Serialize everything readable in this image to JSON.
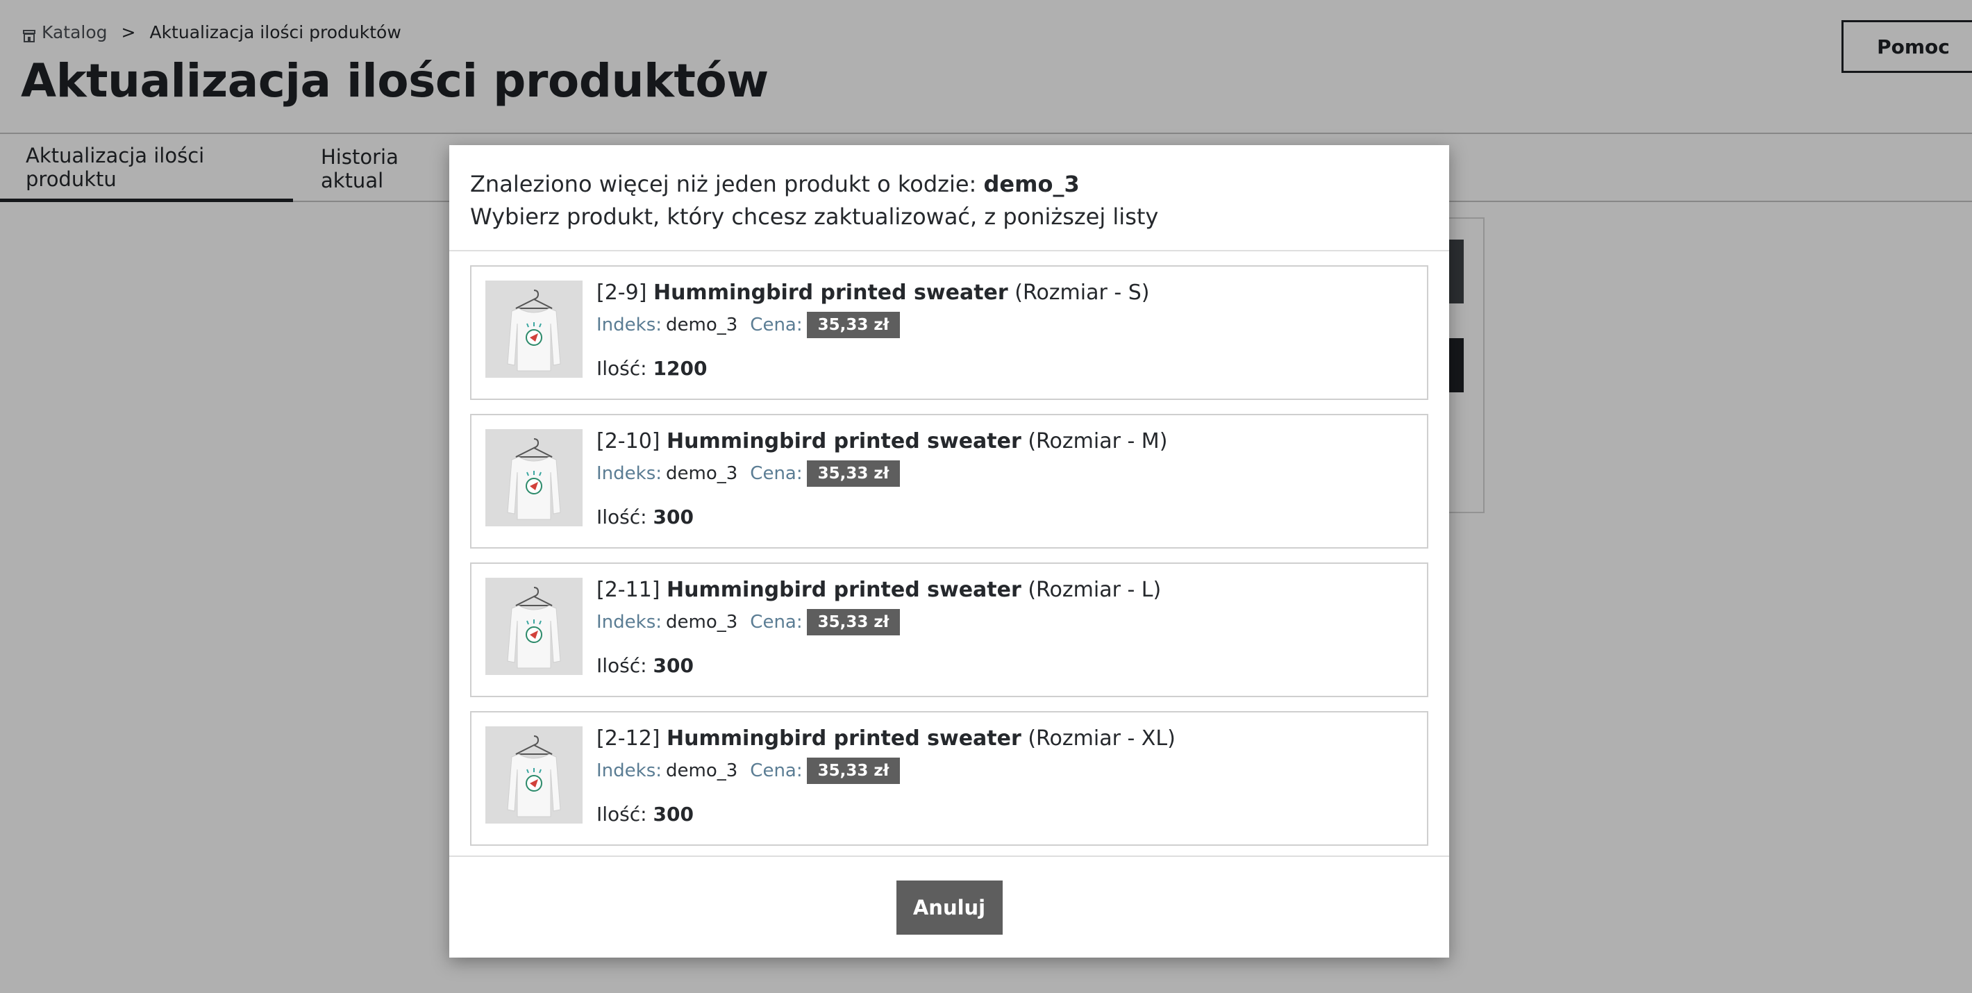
{
  "breadcrumb": {
    "root": "Katalog",
    "separator": ">",
    "current": "Aktualizacja ilości produktów"
  },
  "page": {
    "title": "Aktualizacja ilości produktów",
    "help_label": "Pomoc"
  },
  "tabs": [
    {
      "label": "Aktualizacja ilości produktu",
      "active": true
    },
    {
      "label": "Historia aktual",
      "active": false
    }
  ],
  "modal": {
    "line1_prefix": "Znaleziono więcej niż jeden produkt o kodzie: ",
    "code": "demo_3",
    "line2": "Wybierz produkt, który chcesz zaktualizować, z poniższej listy",
    "cancel_label": "Anuluj",
    "labels": {
      "index": "Indeks:",
      "price": "Cena:",
      "qty": "Ilość:"
    },
    "products": [
      {
        "id": "[2-9]",
        "name": "Hummingbird printed sweater",
        "variant": "(Rozmiar - S)",
        "index": "demo_3",
        "price": "35,33 zł",
        "qty": "1200"
      },
      {
        "id": "[2-10]",
        "name": "Hummingbird printed sweater",
        "variant": "(Rozmiar - M)",
        "index": "demo_3",
        "price": "35,33 zł",
        "qty": "300"
      },
      {
        "id": "[2-11]",
        "name": "Hummingbird printed sweater",
        "variant": "(Rozmiar - L)",
        "index": "demo_3",
        "price": "35,33 zł",
        "qty": "300"
      },
      {
        "id": "[2-12]",
        "name": "Hummingbird printed sweater",
        "variant": "(Rozmiar - XL)",
        "index": "demo_3",
        "price": "35,33 zł",
        "qty": "300"
      }
    ]
  },
  "colors": {
    "overlay": "#000000",
    "price_badge": "#5e5e5e",
    "label_blue": "#5b7d94"
  },
  "icons": {
    "breadcrumb": "store-icon"
  }
}
